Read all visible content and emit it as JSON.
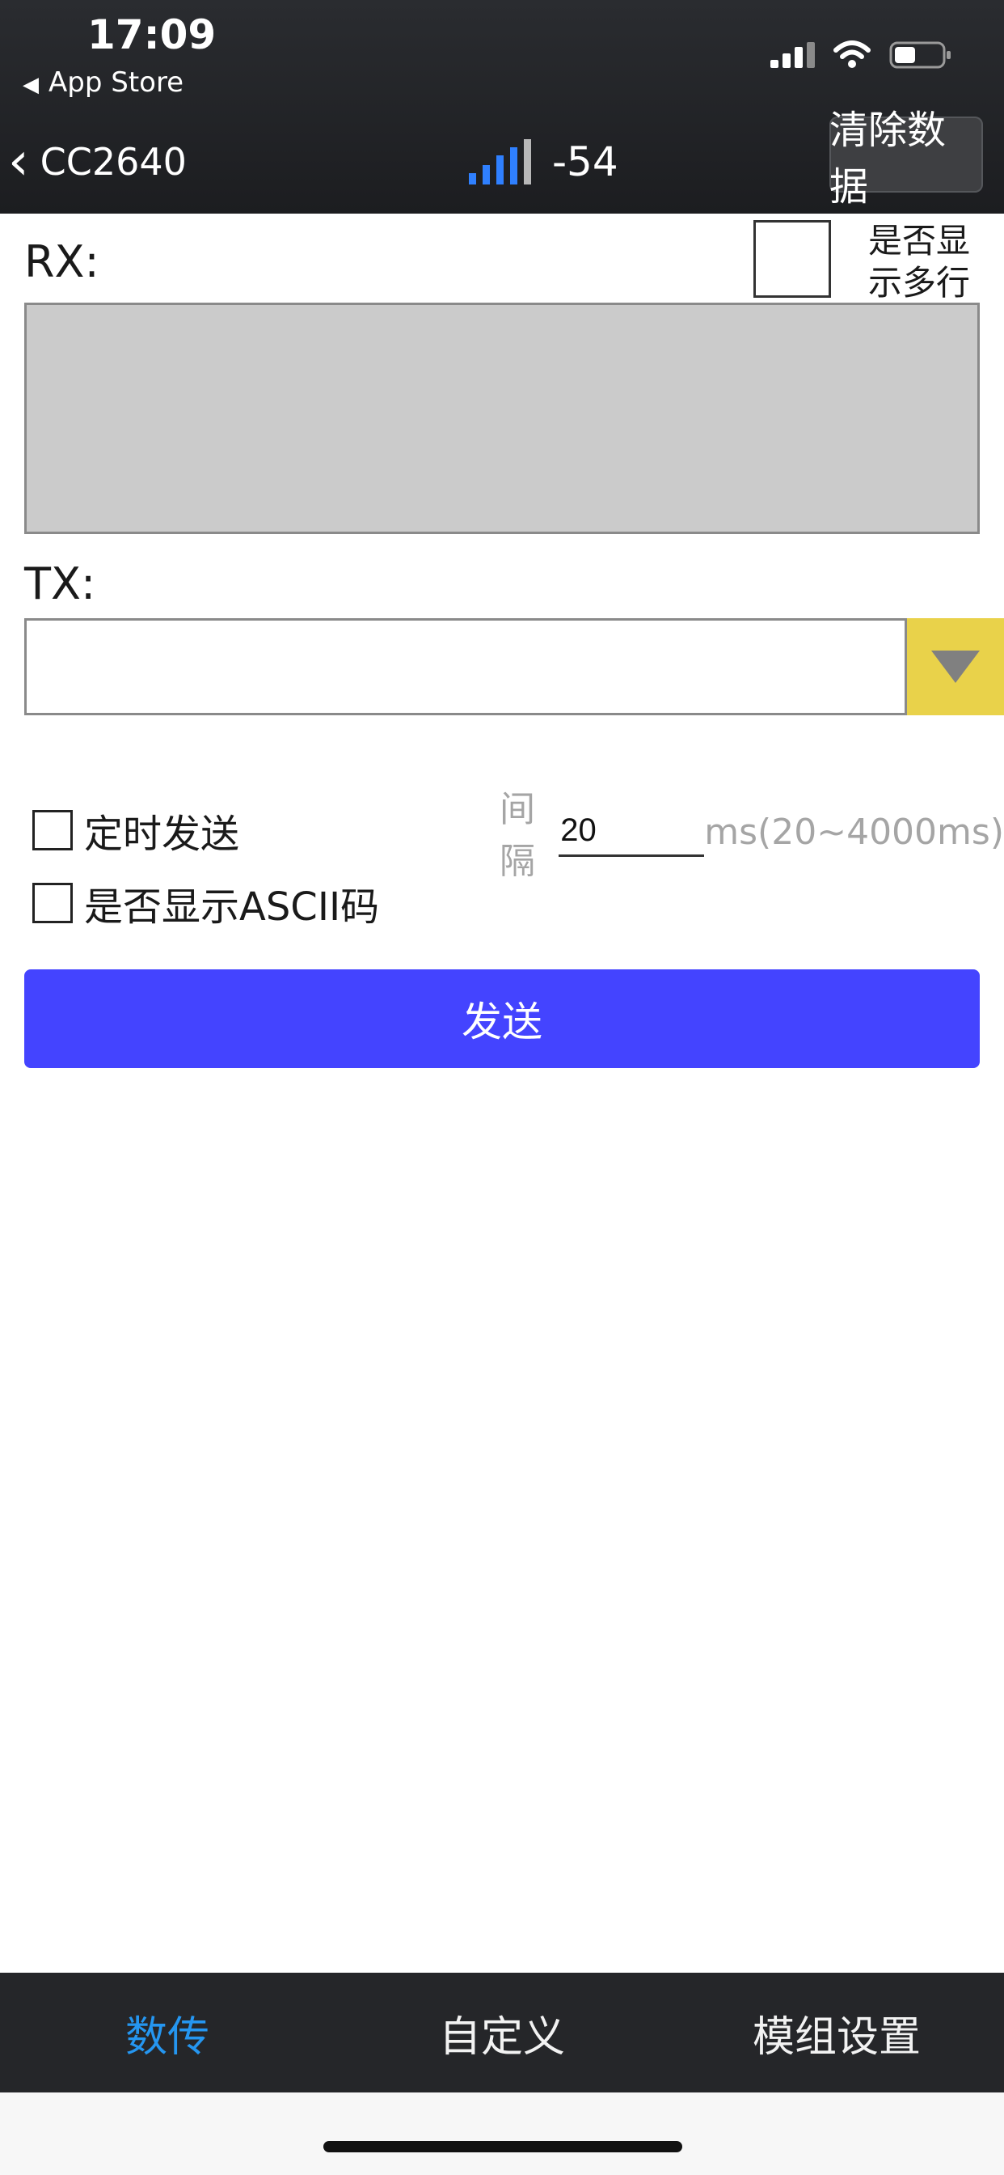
{
  "status_bar": {
    "time": "17:09",
    "back_app_label": "App Store",
    "back_app_icon": "triangle-left-icon",
    "cellular_icon": "cellular-signal-icon",
    "wifi_icon": "wifi-icon",
    "battery_icon": "battery-icon",
    "battery_level": 0.45
  },
  "nav": {
    "back_icon": "chevron-left-icon",
    "device_name": "CC2640",
    "signal_icon": "signal-bars-icon",
    "rssi": "-54",
    "clear_button": "清除数据"
  },
  "rx": {
    "label": "RX:",
    "multiline_label_line1": "是否显",
    "multiline_label_line2": "示多行",
    "multiline_checked": false,
    "content": ""
  },
  "tx": {
    "label": "TX:",
    "value": "",
    "dropdown_icon": "triangle-down-icon"
  },
  "options": {
    "timed_send_label": "定时发送",
    "timed_send_checked": false,
    "interval_label": "间隔",
    "interval_value": "20",
    "interval_unit": "ms(20~4000ms)",
    "ascii_label": "是否显示ASCII码",
    "ascii_checked": false
  },
  "send_button": "发送",
  "tabs": [
    {
      "label": "数传",
      "active": true
    },
    {
      "label": "自定义",
      "active": false
    },
    {
      "label": "模组设置",
      "active": false
    }
  ],
  "colors": {
    "topbar": "#232427",
    "send_button": "#4444ff",
    "active_tab": "#2596f0",
    "dropdown": "#e9d24a",
    "rx_box": "#cbcbcb"
  }
}
